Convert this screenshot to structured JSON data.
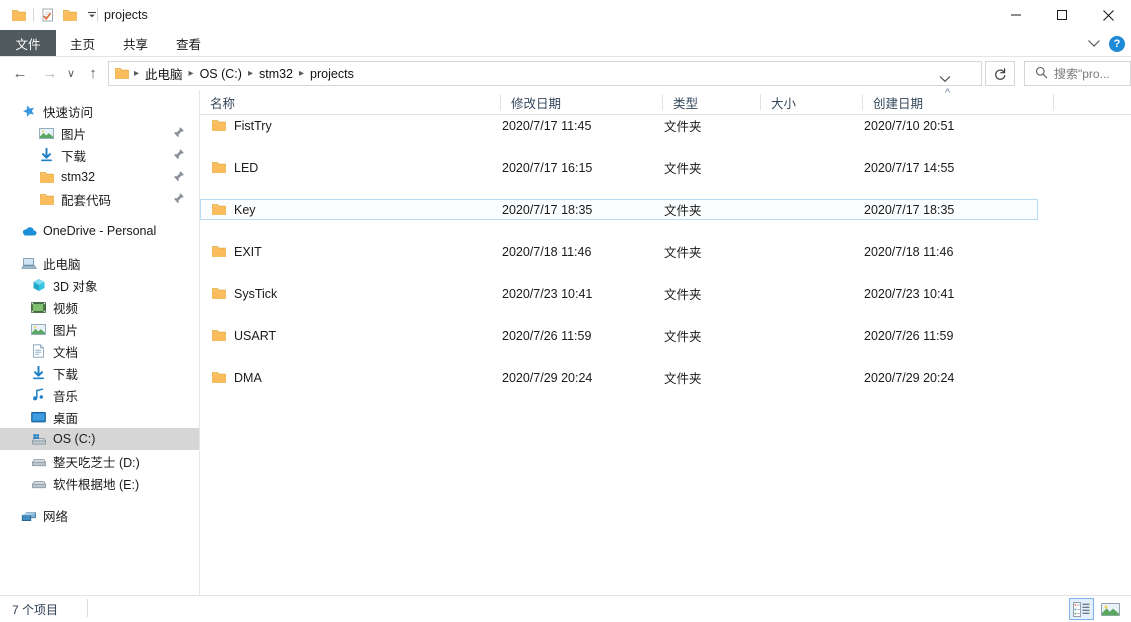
{
  "window": {
    "title": "projects",
    "quick_access_toolbar": [
      {
        "name": "folder-icon",
        "label": "属性文件夹"
      },
      {
        "name": "properties-icon",
        "label": "属性"
      },
      {
        "name": "new-folder-icon",
        "label": "新建文件夹"
      },
      {
        "name": "qat-dropdown-icon",
        "label": "自定义快速访问工具栏"
      }
    ],
    "controls": {
      "minimize": "最小化",
      "maximize": "最大化",
      "close": "关闭"
    }
  },
  "ribbon": {
    "tabs": [
      {
        "label": "文件",
        "active": true
      },
      {
        "label": "主页",
        "active": false
      },
      {
        "label": "共享",
        "active": false
      },
      {
        "label": "查看",
        "active": false
      }
    ],
    "expand_label": "展开功能区",
    "help_label": "?"
  },
  "addressbar": {
    "back_label": "←",
    "forward_label": "→",
    "recent_label": "∨",
    "up_label": "↑",
    "breadcrumbs": [
      "此电脑",
      "OS (C:)",
      "stm32",
      "projects"
    ],
    "dropdown_label": "∨",
    "refresh_label": "↻",
    "search_placeholder": "搜索\"pro..."
  },
  "navigation_pane": {
    "groups": [
      {
        "header": {
          "label": "快速访问",
          "icon": "star-icon"
        },
        "items": [
          {
            "label": "图片",
            "icon": "pictures-icon",
            "pinned": true
          },
          {
            "label": "下载",
            "icon": "downloads-icon",
            "pinned": true
          },
          {
            "label": "stm32",
            "icon": "folder-icon",
            "pinned": true
          },
          {
            "label": "配套代码",
            "icon": "folder-icon",
            "pinned": true
          }
        ]
      },
      {
        "header": {
          "label": "OneDrive - Personal",
          "icon": "onedrive-icon"
        },
        "items": []
      },
      {
        "header": {
          "label": "此电脑",
          "icon": "this-pc-icon"
        },
        "items": [
          {
            "label": "3D 对象",
            "icon": "3d-objects-icon",
            "pinned": false
          },
          {
            "label": "视频",
            "icon": "videos-icon",
            "pinned": false
          },
          {
            "label": "图片",
            "icon": "pictures-icon",
            "pinned": false
          },
          {
            "label": "文档",
            "icon": "documents-icon",
            "pinned": false
          },
          {
            "label": "下载",
            "icon": "downloads-icon",
            "pinned": false
          },
          {
            "label": "音乐",
            "icon": "music-icon",
            "pinned": false
          },
          {
            "label": "桌面",
            "icon": "desktop-icon",
            "pinned": false
          },
          {
            "label": "OS (C:)",
            "icon": "windows-drive-icon",
            "pinned": false,
            "selected": true
          },
          {
            "label": "整天吃芝士 (D:)",
            "icon": "drive-icon",
            "pinned": false
          },
          {
            "label": "软件根据地 (E:)",
            "icon": "drive-icon",
            "pinned": false
          }
        ]
      },
      {
        "header": {
          "label": "网络",
          "icon": "network-icon"
        },
        "items": []
      }
    ]
  },
  "file_list": {
    "columns": [
      {
        "key": "name",
        "label": "名称",
        "sorted": false
      },
      {
        "key": "modified",
        "label": "修改日期",
        "sorted": false
      },
      {
        "key": "type",
        "label": "类型",
        "sorted": false
      },
      {
        "key": "size",
        "label": "大小",
        "sorted": false
      },
      {
        "key": "created",
        "label": "创建日期",
        "sorted": true,
        "sort_direction": "asc",
        "sort_glyph": "^"
      }
    ],
    "rows": [
      {
        "name": "FistTry",
        "modified": "2020/7/17 11:45",
        "type": "文件夹",
        "size": "",
        "created": "2020/7/10 20:51",
        "icon": "folder-icon",
        "focused": false
      },
      {
        "name": "LED",
        "modified": "2020/7/17 16:15",
        "type": "文件夹",
        "size": "",
        "created": "2020/7/17 14:55",
        "icon": "folder-icon",
        "focused": false
      },
      {
        "name": "Key",
        "modified": "2020/7/17 18:35",
        "type": "文件夹",
        "size": "",
        "created": "2020/7/17 18:35",
        "icon": "folder-icon",
        "focused": true
      },
      {
        "name": "EXIT",
        "modified": "2020/7/18 11:46",
        "type": "文件夹",
        "size": "",
        "created": "2020/7/18 11:46",
        "icon": "folder-icon",
        "focused": false
      },
      {
        "name": "SysTick",
        "modified": "2020/7/23 10:41",
        "type": "文件夹",
        "size": "",
        "created": "2020/7/23 10:41",
        "icon": "folder-icon",
        "focused": false
      },
      {
        "name": "USART",
        "modified": "2020/7/26 11:59",
        "type": "文件夹",
        "size": "",
        "created": "2020/7/26 11:59",
        "icon": "folder-icon",
        "focused": false
      },
      {
        "name": "DMA",
        "modified": "2020/7/29 20:24",
        "type": "文件夹",
        "size": "",
        "created": "2020/7/29 20:24",
        "icon": "folder-icon",
        "focused": false
      }
    ]
  },
  "status_bar": {
    "item_count": "7 个项目",
    "views": [
      {
        "name": "details-view-button",
        "label": "详细信息",
        "active": true
      },
      {
        "name": "large-icons-view-button",
        "label": "大图标",
        "active": false
      }
    ]
  },
  "colors": {
    "accent": "#1e8ad6",
    "folder": "#fcc66d",
    "file_tab": "#4f5b5e",
    "focus_border": "#b6dbf4",
    "nav_selected": "#d6d6d6",
    "header_text": "#35495c"
  }
}
